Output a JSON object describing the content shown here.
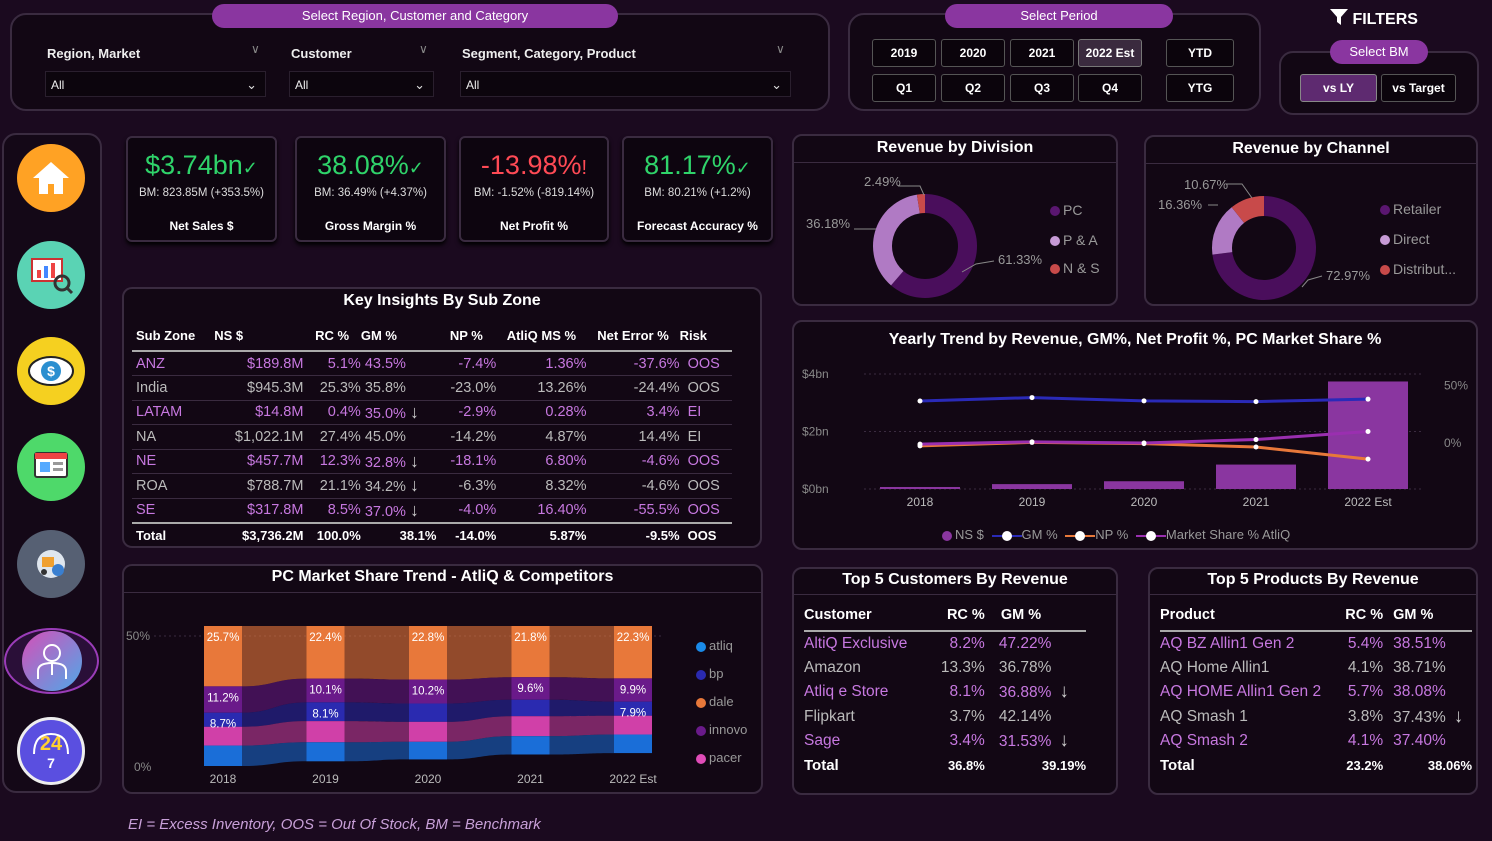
{
  "filters": {
    "region_pill": "Select Region, Customer and Category",
    "region_label": "Region, Market",
    "customer_label": "Customer",
    "segment_label": "Segment, Category, Product",
    "region_value": "All",
    "customer_value": "All",
    "segment_value": "All",
    "period_pill": "Select Period",
    "years": [
      "2019",
      "2020",
      "2021",
      "2022 Est"
    ],
    "quarters": [
      "Q1",
      "Q2",
      "Q3",
      "Q4"
    ],
    "ytd": "YTD",
    "ytg": "YTG",
    "filters_title": "FILTERS",
    "bm_pill": "Select BM",
    "vs_ly": "vs LY",
    "vs_target": "vs Target"
  },
  "nav": [
    "home-icon",
    "finance-view-icon",
    "sales-view-icon",
    "marketing-view-icon",
    "supply-chain-view-icon",
    "executive-view-icon",
    "support-icon"
  ],
  "kpis": [
    {
      "value": "$3.74bn",
      "mark": "✓",
      "bm": "BM: 823.85M (+353.5%)",
      "name": "Net Sales $",
      "color": "#2fd36a"
    },
    {
      "value": "38.08%",
      "mark": "✓",
      "bm": "BM: 36.49% (+4.37%)",
      "name": "Gross Margin %",
      "color": "#2fd36a"
    },
    {
      "value": "-13.98%",
      "mark": "!",
      "bm": "BM: -1.52% (-819.14%)",
      "name": "Net Profit %",
      "color": "#ff4a55"
    },
    {
      "value": "81.17%",
      "mark": "✓",
      "bm": "BM: 80.21% (+1.2%)",
      "name": "Forecast Accuracy %",
      "color": "#2fd36a"
    }
  ],
  "insights": {
    "title": "Key Insights By Sub Zone",
    "headers": [
      "Sub Zone",
      "NS $",
      "RC %",
      "GM %",
      "NP %",
      "AtliQ MS %",
      "Net Error %",
      "Risk"
    ],
    "rows": [
      {
        "zone": "ANZ",
        "ns": "$189.8M",
        "rc": "5.1%",
        "gm": "43.5%",
        "arrow": "",
        "np": "-7.4%",
        "ms": "1.36%",
        "ne": "-37.6%",
        "risk": "OOS",
        "hl": true
      },
      {
        "zone": "India",
        "ns": "$945.3M",
        "rc": "25.3%",
        "gm": "35.8%",
        "arrow": "",
        "np": "-23.0%",
        "ms": "13.26%",
        "ne": "-24.4%",
        "risk": "OOS",
        "hl": false
      },
      {
        "zone": "LATAM",
        "ns": "$14.8M",
        "rc": "0.4%",
        "gm": "35.0%",
        "arrow": "↓",
        "np": "-2.9%",
        "ms": "0.28%",
        "ne": "3.4%",
        "risk": "EI",
        "hl": true
      },
      {
        "zone": "NA",
        "ns": "$1,022.1M",
        "rc": "27.4%",
        "gm": "45.0%",
        "arrow": "",
        "np": "-14.2%",
        "ms": "4.87%",
        "ne": "14.4%",
        "risk": "EI",
        "hl": false
      },
      {
        "zone": "NE",
        "ns": "$457.7M",
        "rc": "12.3%",
        "gm": "32.8%",
        "arrow": "↓",
        "np": "-18.1%",
        "ms": "6.80%",
        "ne": "-4.6%",
        "risk": "OOS",
        "hl": true
      },
      {
        "zone": "ROA",
        "ns": "$788.7M",
        "rc": "21.1%",
        "gm": "34.2%",
        "arrow": "↓",
        "np": "-6.3%",
        "ms": "8.32%",
        "ne": "-4.6%",
        "risk": "OOS",
        "hl": false
      },
      {
        "zone": "SE",
        "ns": "$317.8M",
        "rc": "8.5%",
        "gm": "37.0%",
        "arrow": "↓",
        "np": "-4.0%",
        "ms": "16.40%",
        "ne": "-55.5%",
        "risk": "OOS",
        "hl": true
      }
    ],
    "total": {
      "zone": "Total",
      "ns": "$3,736.2M",
      "rc": "100.0%",
      "gm": "38.1%",
      "np": "-14.0%",
      "ms": "5.87%",
      "ne": "-9.5%",
      "risk": "OOS"
    }
  },
  "division": {
    "title": "Revenue by Division",
    "labels": [
      "2.49%",
      "36.18%",
      "61.33%"
    ],
    "legend": [
      "PC",
      "P & A",
      "N & S"
    ]
  },
  "channel": {
    "title": "Revenue by Channel",
    "labels": [
      "10.67%",
      "16.36%",
      "72.97%"
    ],
    "legend": [
      "Retailer",
      "Direct",
      "Distribut..."
    ]
  },
  "trend": {
    "title": "Yearly Trend by Revenue, GM%, Net Profit %, PC Market Share %",
    "yleft": [
      "$4bn",
      "$2bn",
      "$0bn"
    ],
    "yright": [
      "50%",
      "0%"
    ],
    "legend": [
      "NS $",
      "GM %",
      "NP %",
      "Market Share % AtliQ"
    ]
  },
  "market": {
    "title": "PC Market Share Trend - AtliQ & Competitors",
    "yaxis": [
      "50%",
      "0%"
    ],
    "legend": [
      "atliq",
      "bp",
      "dale",
      "innovo",
      "pacer"
    ],
    "top_labels": [
      "25.7%",
      "22.4%",
      "22.8%",
      "21.8%",
      "22.3%"
    ],
    "mid_labels": [
      "11.2%",
      "10.1%",
      "10.2%",
      "9.6%",
      "9.9%"
    ],
    "low_labels": [
      "8.7%",
      "8.1%",
      "",
      "",
      "7.9%"
    ]
  },
  "customers": {
    "title": "Top 5 Customers By Revenue",
    "headers": [
      "Customer",
      "RC %",
      "GM %"
    ],
    "rows": [
      {
        "name": "AltiQ Exclusive",
        "rc": "8.2%",
        "gm": "47.22%",
        "arrow": "",
        "hl": true
      },
      {
        "name": "Amazon",
        "rc": "13.3%",
        "gm": "36.78%",
        "arrow": "",
        "hl": false
      },
      {
        "name": "Atliq e Store",
        "rc": "8.1%",
        "gm": "36.88%",
        "arrow": "↓",
        "hl": true
      },
      {
        "name": "Flipkart",
        "rc": "3.7%",
        "gm": "42.14%",
        "arrow": "",
        "hl": false
      },
      {
        "name": "Sage",
        "rc": "3.4%",
        "gm": "31.53%",
        "arrow": "↓",
        "hl": true
      }
    ],
    "total": {
      "name": "Total",
      "rc": "36.8%",
      "gm": "39.19%"
    }
  },
  "products": {
    "title": "Top 5 Products By Revenue",
    "headers": [
      "Product",
      "RC %",
      "GM %"
    ],
    "rows": [
      {
        "name": "AQ BZ Allin1 Gen 2",
        "rc": "5.4%",
        "gm": "38.51%",
        "arrow": "",
        "hl": true
      },
      {
        "name": "AQ Home Allin1",
        "rc": "4.1%",
        "gm": "38.71%",
        "arrow": "",
        "hl": false
      },
      {
        "name": "AQ HOME Allin1 Gen 2",
        "rc": "5.7%",
        "gm": "38.08%",
        "arrow": "",
        "hl": true
      },
      {
        "name": "AQ Smash 1",
        "rc": "3.8%",
        "gm": "37.43%",
        "arrow": "↓",
        "hl": false
      },
      {
        "name": "AQ Smash 2",
        "rc": "4.1%",
        "gm": "37.40%",
        "arrow": "",
        "hl": true
      }
    ],
    "total": {
      "name": "Total",
      "rc": "23.2%",
      "gm": "38.06%"
    }
  },
  "footer": "EI = Excess Inventory, OOS = Out Of Stock, BM = Benchmark",
  "chart_data": [
    {
      "type": "pie",
      "title": "Revenue by Division",
      "categories": [
        "PC",
        "P & A",
        "N & S"
      ],
      "values": [
        61.33,
        36.18,
        2.49
      ],
      "colors": [
        "#4a0e5c",
        "#b07ac4",
        "#c84a4a"
      ]
    },
    {
      "type": "pie",
      "title": "Revenue by Channel",
      "categories": [
        "Retailer",
        "Direct",
        "Distribut..."
      ],
      "values": [
        72.97,
        16.36,
        10.67
      ],
      "colors": [
        "#4a0e5c",
        "#b07ac4",
        "#c84a4a"
      ]
    },
    {
      "type": "bar",
      "title": "Yearly Trend by Revenue, GM%, Net Profit %, PC Market Share %",
      "categories": [
        "2018",
        "2019",
        "2020",
        "2021",
        "2022 Est"
      ],
      "series": [
        {
          "name": "NS $",
          "type": "bar",
          "values": [
            0.07,
            0.17,
            0.27,
            0.85,
            3.74
          ],
          "color": "#8a36a0"
        },
        {
          "name": "GM %",
          "type": "line",
          "values": [
            36.5,
            39.5,
            36.6,
            36.0,
            38.1
          ],
          "color": "#2a2ab8"
        },
        {
          "name": "NP %",
          "type": "line",
          "values": [
            -2.5,
            0.5,
            -0.5,
            -3.5,
            -14.0
          ],
          "color": "#e8783a"
        },
        {
          "name": "Market Share % AtliQ",
          "type": "line",
          "values": [
            -1.0,
            1.0,
            0.0,
            3.0,
            10.0
          ],
          "color": "#9a2fb0"
        }
      ],
      "ylim_left": [
        0,
        4
      ],
      "ylim_right": [
        -40,
        60
      ]
    },
    {
      "type": "area",
      "title": "PC Market Share Trend - AtliQ & Competitors",
      "categories": [
        "2018",
        "2019",
        "2020",
        "2021",
        "2022 Est"
      ],
      "series": [
        {
          "name": "atliq",
          "values": [
            8.7,
            8.1,
            7.5,
            7.8,
            7.9
          ],
          "color": "#1a6ed8"
        },
        {
          "name": "bp",
          "values": [
            6.0,
            8.0,
            7.8,
            7.0,
            6.0
          ],
          "color": "#2a2ab0"
        },
        {
          "name": "dale",
          "values": [
            25.7,
            22.4,
            22.8,
            21.8,
            22.3
          ],
          "color": "#e8783a"
        },
        {
          "name": "innovo",
          "values": [
            11.2,
            10.1,
            10.2,
            9.6,
            9.9
          ],
          "color": "#6a1a8a"
        },
        {
          "name": "pacer",
          "values": [
            8.0,
            9.0,
            8.5,
            8.5,
            8.0
          ],
          "color": "#d040a8"
        }
      ],
      "ylim": [
        0,
        50
      ]
    }
  ]
}
